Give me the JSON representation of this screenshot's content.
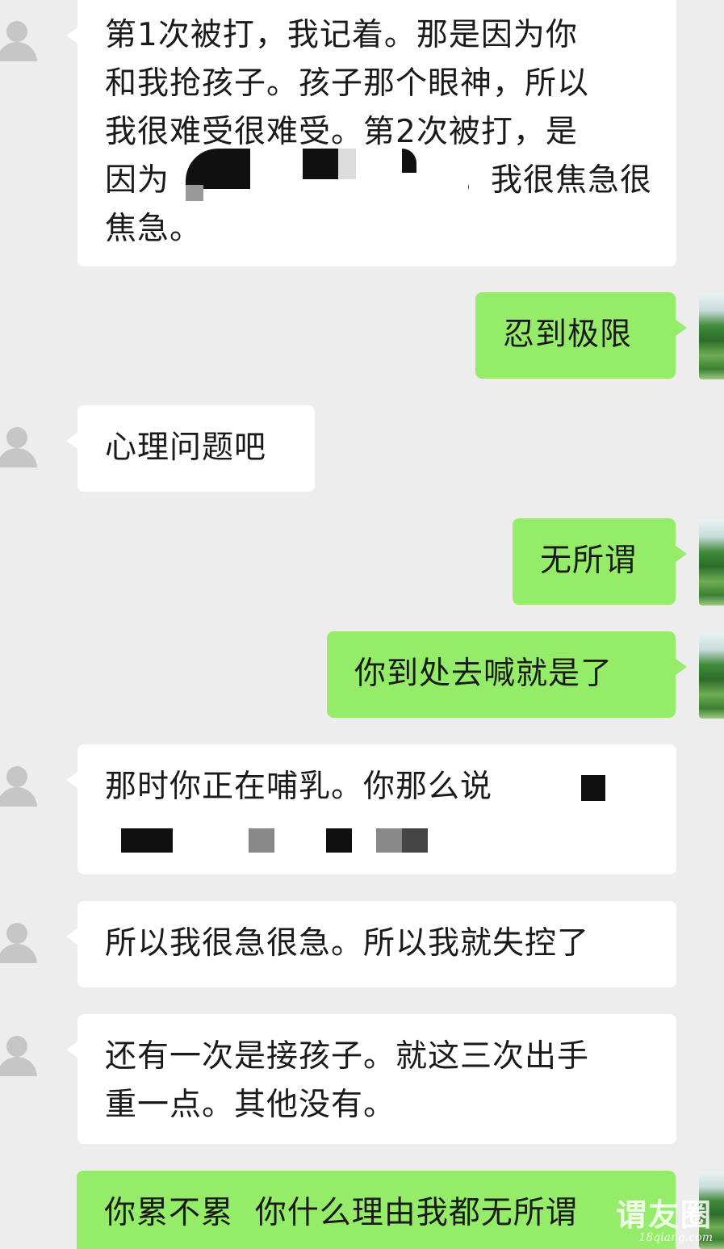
{
  "messages": [
    {
      "side": "in",
      "text": "第1次被打，我记着。那是因为你和我抢孩子。孩子那个眼神，所以我很难受很难受。第2次被打，是因为[redacted]是，我很焦急很焦急。"
    },
    {
      "side": "out",
      "text": "忍到极限"
    },
    {
      "side": "in",
      "text": "心理问题吧"
    },
    {
      "side": "out",
      "text": "无所谓"
    },
    {
      "side": "out",
      "text": "你到处去喊就是了"
    },
    {
      "side": "in",
      "text": "那时你正在哺乳。你那么说"
    },
    {
      "side": "in",
      "text": "所以我很急很急。所以我就失控了"
    },
    {
      "side": "in",
      "text": "还有一次是接孩子。就这三次出手重一点。其他没有。"
    },
    {
      "side": "out",
      "text": "你累不累  你什么理由我都无所谓"
    }
  ],
  "msg1_lines": [
    "第1次被打，我记着。那是因为你",
    "和我抢孩子。孩子那个眼神，所以",
    "我很难受很难受。第2次被打，是",
    "因为",
    "是，我很焦急很",
    "焦急。"
  ],
  "msg8_lines": [
    "还有一次是接孩子。就这三次出手",
    "重一点。其他没有。"
  ],
  "watermark": {
    "main": "谓友圈",
    "sub": "18qiang.com"
  },
  "colors": {
    "background": "#ededed",
    "incoming": "#ffffff",
    "outgoing": "#95ec69",
    "text": "#1a1a1a"
  }
}
